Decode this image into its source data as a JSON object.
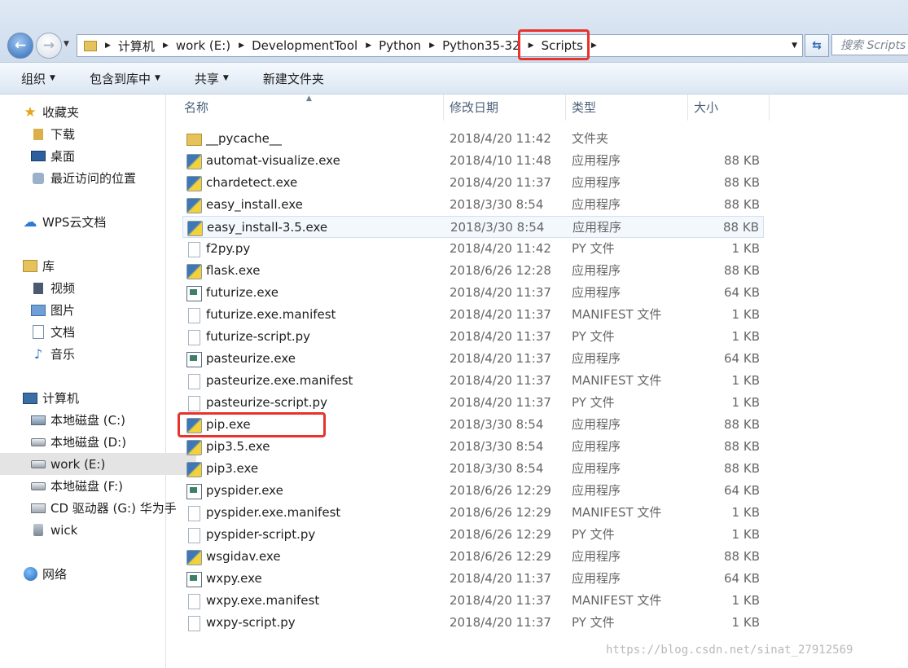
{
  "address": {
    "crumbs": [
      "计算机",
      "work (E:)",
      "DevelopmentTool",
      "Python",
      "Python35-32",
      "Scripts"
    ],
    "search_placeholder": "搜索 Scripts"
  },
  "toolbar": {
    "organize": "组织",
    "include_library": "包含到库中",
    "share": "共享",
    "new_folder": "新建文件夹"
  },
  "sidebar": {
    "favorites": "收藏夹",
    "downloads": "下载",
    "desktop": "桌面",
    "recent": "最近访问的位置",
    "wps": "WPS云文档",
    "libraries": "库",
    "videos": "视频",
    "pictures": "图片",
    "documents": "文档",
    "music": "音乐",
    "computer": "计算机",
    "drive_c": "本地磁盘 (C:)",
    "drive_d": "本地磁盘 (D:)",
    "drive_e": "work (E:)",
    "drive_f": "本地磁盘 (F:)",
    "drive_g": "CD 驱动器 (G:) 华为手",
    "wick": "wick",
    "network": "网络"
  },
  "columns": {
    "name": "名称",
    "date": "修改日期",
    "type": "类型",
    "size": "大小"
  },
  "files": [
    {
      "name": "__pycache__",
      "date": "2018/4/20 11:42",
      "type": "文件夹",
      "size": "",
      "icon": "folder-icon"
    },
    {
      "name": "automat-visualize.exe",
      "date": "2018/4/10 11:48",
      "type": "应用程序",
      "size": "88 KB",
      "icon": "python-exe-icon"
    },
    {
      "name": "chardetect.exe",
      "date": "2018/4/20 11:37",
      "type": "应用程序",
      "size": "88 KB",
      "icon": "python-exe-icon"
    },
    {
      "name": "easy_install.exe",
      "date": "2018/3/30 8:54",
      "type": "应用程序",
      "size": "88 KB",
      "icon": "python-exe-icon"
    },
    {
      "name": "easy_install-3.5.exe",
      "date": "2018/3/30 8:54",
      "type": "应用程序",
      "size": "88 KB",
      "icon": "python-exe-icon"
    },
    {
      "name": "f2py.py",
      "date": "2018/4/20 11:42",
      "type": "PY 文件",
      "size": "1 KB",
      "icon": "file-icon"
    },
    {
      "name": "flask.exe",
      "date": "2018/6/26 12:28",
      "type": "应用程序",
      "size": "88 KB",
      "icon": "python-exe-icon"
    },
    {
      "name": "futurize.exe",
      "date": "2018/4/20 11:37",
      "type": "应用程序",
      "size": "64 KB",
      "icon": "window-exe-icon"
    },
    {
      "name": "futurize.exe.manifest",
      "date": "2018/4/20 11:37",
      "type": "MANIFEST 文件",
      "size": "1 KB",
      "icon": "file-icon"
    },
    {
      "name": "futurize-script.py",
      "date": "2018/4/20 11:37",
      "type": "PY 文件",
      "size": "1 KB",
      "icon": "file-icon"
    },
    {
      "name": "pasteurize.exe",
      "date": "2018/4/20 11:37",
      "type": "应用程序",
      "size": "64 KB",
      "icon": "window-exe-icon"
    },
    {
      "name": "pasteurize.exe.manifest",
      "date": "2018/4/20 11:37",
      "type": "MANIFEST 文件",
      "size": "1 KB",
      "icon": "file-icon"
    },
    {
      "name": "pasteurize-script.py",
      "date": "2018/4/20 11:37",
      "type": "PY 文件",
      "size": "1 KB",
      "icon": "file-icon"
    },
    {
      "name": "pip.exe",
      "date": "2018/3/30 8:54",
      "type": "应用程序",
      "size": "88 KB",
      "icon": "python-exe-icon"
    },
    {
      "name": "pip3.5.exe",
      "date": "2018/3/30 8:54",
      "type": "应用程序",
      "size": "88 KB",
      "icon": "python-exe-icon"
    },
    {
      "name": "pip3.exe",
      "date": "2018/3/30 8:54",
      "type": "应用程序",
      "size": "88 KB",
      "icon": "python-exe-icon"
    },
    {
      "name": "pyspider.exe",
      "date": "2018/6/26 12:29",
      "type": "应用程序",
      "size": "64 KB",
      "icon": "window-exe-icon"
    },
    {
      "name": "pyspider.exe.manifest",
      "date": "2018/6/26 12:29",
      "type": "MANIFEST 文件",
      "size": "1 KB",
      "icon": "file-icon"
    },
    {
      "name": "pyspider-script.py",
      "date": "2018/6/26 12:29",
      "type": "PY 文件",
      "size": "1 KB",
      "icon": "file-icon"
    },
    {
      "name": "wsgidav.exe",
      "date": "2018/6/26 12:29",
      "type": "应用程序",
      "size": "88 KB",
      "icon": "python-exe-icon"
    },
    {
      "name": "wxpy.exe",
      "date": "2018/4/20 11:37",
      "type": "应用程序",
      "size": "64 KB",
      "icon": "window-exe-icon"
    },
    {
      "name": "wxpy.exe.manifest",
      "date": "2018/4/20 11:37",
      "type": "MANIFEST 文件",
      "size": "1 KB",
      "icon": "file-icon"
    },
    {
      "name": "wxpy-script.py",
      "date": "2018/4/20 11:37",
      "type": "PY 文件",
      "size": "1 KB",
      "icon": "file-icon"
    }
  ],
  "selected_file": "easy_install-3.5.exe",
  "highlight_color": "#e8332c",
  "watermark": "https://blog.csdn.net/sinat_27912569"
}
